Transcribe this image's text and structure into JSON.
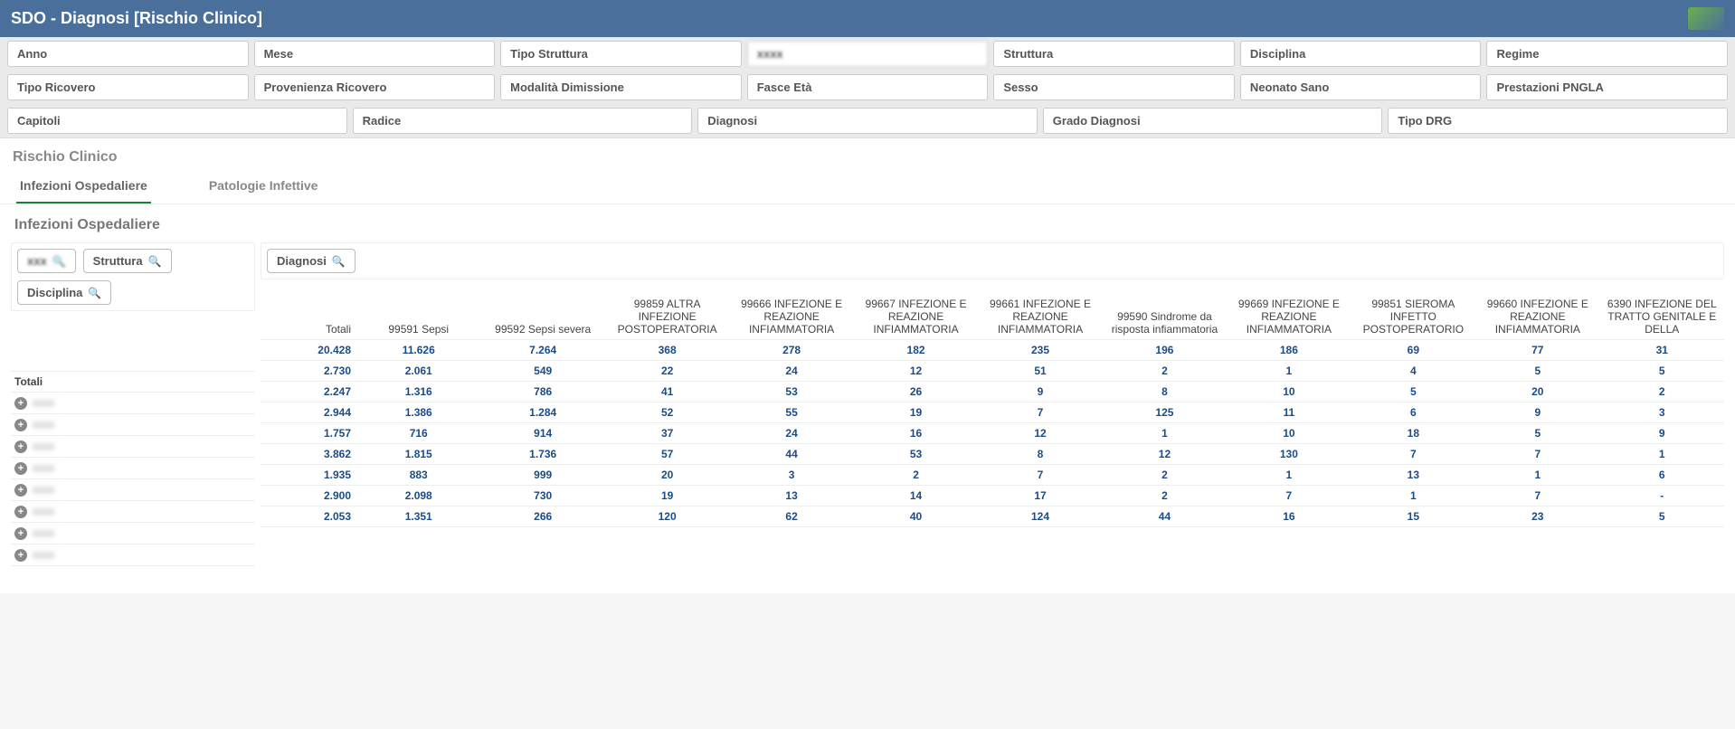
{
  "header": {
    "title": "SDO - Diagnosi [Rischio Clinico]"
  },
  "filters": {
    "row1": [
      "Anno",
      "Mese",
      "Tipo Struttura",
      "",
      "Struttura",
      "Disciplina",
      "Regime"
    ],
    "row2": [
      "Tipo Ricovero",
      "Provenienza Ricovero",
      "Modalità Dimissione",
      "Fasce Età",
      "Sesso",
      "Neonato Sano",
      "Prestazioni PNGLA"
    ],
    "row3": [
      "Capitoli",
      "Radice",
      "Diagnosi",
      "Grado Diagnosi",
      "Tipo DRG"
    ]
  },
  "section": {
    "title": "Rischio Clinico",
    "tabs": [
      "Infezioni Ospedaliere",
      "Patologie Infettive"
    ],
    "active": 0,
    "subtitle": "Infezioni Ospedaliere"
  },
  "left_chips": [
    "",
    "Struttura",
    "Disciplina"
  ],
  "right_chips": [
    "Diagnosi"
  ],
  "columns": [
    "Totali",
    "99591 Sepsi",
    "99592 Sepsi severa",
    "99859 ALTRA INFEZIONE POSTOPERATORIA",
    "99666 INFEZIONE E REAZIONE INFIAMMATORIA",
    "99667 INFEZIONE E REAZIONE INFIAMMATORIA",
    "99661 INFEZIONE E REAZIONE INFIAMMATORIA",
    "99590 Sindrome da risposta infiammatoria",
    "99669 INFEZIONE E REAZIONE INFIAMMATORIA",
    "99851 SIEROMA INFETTO POSTOPERATORIO",
    "99660 INFEZIONE E REAZIONE INFIAMMATORIA",
    "6390 INFEZIONE DEL TRATTO GENITALE E DELLA"
  ],
  "rows": [
    {
      "label": "Totali",
      "expand": false,
      "blur": false,
      "v": [
        "20.428",
        "11.626",
        "7.264",
        "368",
        "278",
        "182",
        "235",
        "196",
        "186",
        "69",
        "77",
        "31"
      ]
    },
    {
      "label": "xxxx",
      "expand": true,
      "blur": true,
      "v": [
        "2.730",
        "2.061",
        "549",
        "22",
        "24",
        "12",
        "51",
        "2",
        "1",
        "4",
        "5",
        "5"
      ]
    },
    {
      "label": "xxxx",
      "expand": true,
      "blur": true,
      "v": [
        "2.247",
        "1.316",
        "786",
        "41",
        "53",
        "26",
        "9",
        "8",
        "10",
        "5",
        "20",
        "2"
      ]
    },
    {
      "label": "xxxx",
      "expand": true,
      "blur": true,
      "v": [
        "2.944",
        "1.386",
        "1.284",
        "52",
        "55",
        "19",
        "7",
        "125",
        "11",
        "6",
        "9",
        "3"
      ]
    },
    {
      "label": "xxxx",
      "expand": true,
      "blur": true,
      "v": [
        "1.757",
        "716",
        "914",
        "37",
        "24",
        "16",
        "12",
        "1",
        "10",
        "18",
        "5",
        "9"
      ]
    },
    {
      "label": "xxxx",
      "expand": true,
      "blur": true,
      "v": [
        "3.862",
        "1.815",
        "1.736",
        "57",
        "44",
        "53",
        "8",
        "12",
        "130",
        "7",
        "7",
        "1"
      ]
    },
    {
      "label": "xxxx",
      "expand": true,
      "blur": true,
      "v": [
        "1.935",
        "883",
        "999",
        "20",
        "3",
        "2",
        "7",
        "2",
        "1",
        "13",
        "1",
        "6"
      ]
    },
    {
      "label": "xxxx",
      "expand": true,
      "blur": true,
      "v": [
        "2.900",
        "2.098",
        "730",
        "19",
        "13",
        "14",
        "17",
        "2",
        "7",
        "1",
        "7",
        "-"
      ]
    },
    {
      "label": "xxxx",
      "expand": true,
      "blur": true,
      "v": [
        "2.053",
        "1.351",
        "266",
        "120",
        "62",
        "40",
        "124",
        "44",
        "16",
        "15",
        "23",
        "5"
      ]
    }
  ]
}
